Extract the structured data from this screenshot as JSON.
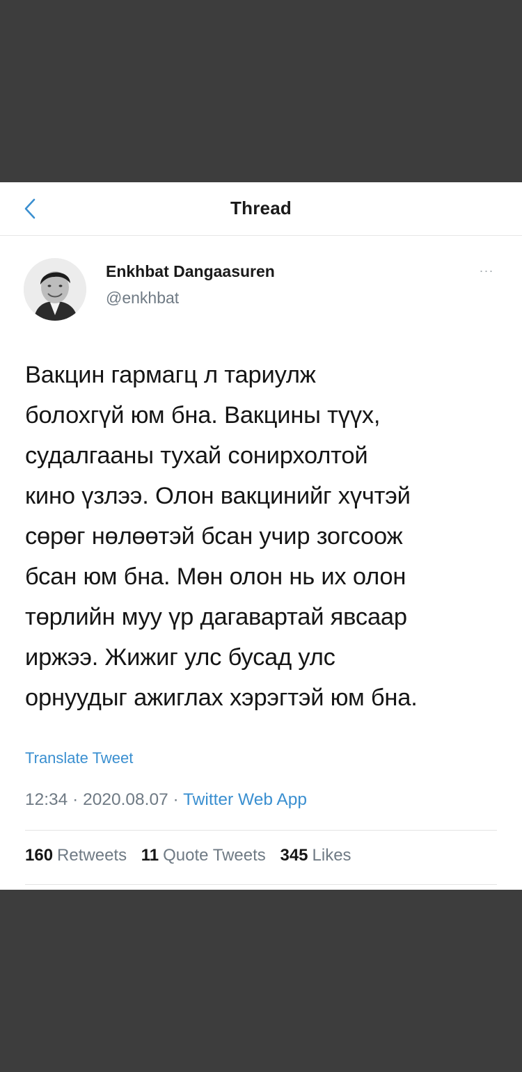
{
  "nav": {
    "back_icon": "chevron-left-icon",
    "title": "Thread",
    "accent_color": "#3a8fd0"
  },
  "author": {
    "name": "Enkhbat Dangaasuren",
    "handle": "@enkhbat",
    "more_label": "···"
  },
  "tweet": {
    "text": "Вакцин гармагц л тариулж\nболохгүй юм бна. Вакцины түүх,\nсудалгааны тухай сонирхолтой\nкино үзлээ. Олон вакцинийг хүчтэй\nсөрөг нөлөөтэй бсан учир зогсоож\nбсан юм бна. Мөн олон нь их олон\nтөрлийн муу үр дагавартай явсаар\nиржээ. Жижиг улс бусад улс\nорнуудыг ажиглах хэрэгтэй юм бна.",
    "translate_label": "Translate Tweet",
    "time": "12:34",
    "date": "2020.08.07",
    "separator": " · ",
    "source": "Twitter Web App"
  },
  "stats": {
    "retweets_count": "160",
    "retweets_label": "Retweets",
    "quotes_count": "11",
    "quotes_label": "Quote Tweets",
    "likes_count": "345",
    "likes_label": "Likes"
  }
}
